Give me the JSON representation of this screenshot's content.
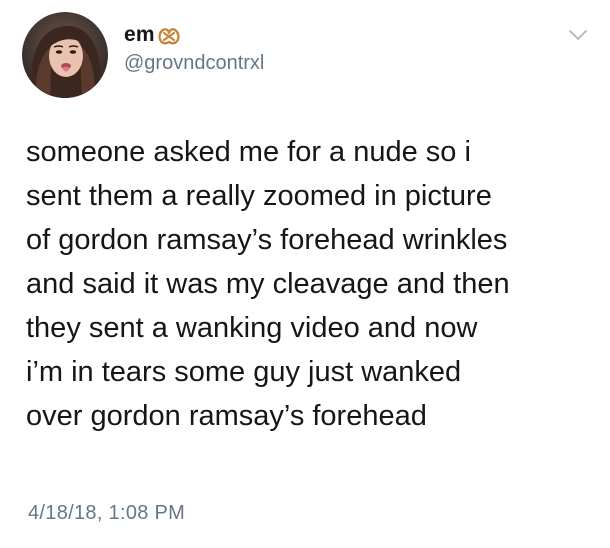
{
  "author": {
    "display_name": "em",
    "handle": "@grovndcontrxl",
    "name_emoji": "pretzel-icon"
  },
  "tweet": {
    "lines": [
      "someone asked me for a nude so i",
      "sent them a really zoomed in picture",
      "of gordon ramsay’s forehead wrinkles",
      "and said it was my cleavage and then",
      "they sent a wanking video and now",
      "i’m in tears some guy just wanked",
      "over gordon ramsay’s forehead"
    ],
    "timestamp": "4/18/18, 1:08 PM"
  },
  "icons": {
    "menu": "chevron-down-icon",
    "avatar": "avatar"
  },
  "colors": {
    "text": "#14171a",
    "secondary": "#657786",
    "chevron": "#aab8c2",
    "pretzel": "#c9853a"
  }
}
